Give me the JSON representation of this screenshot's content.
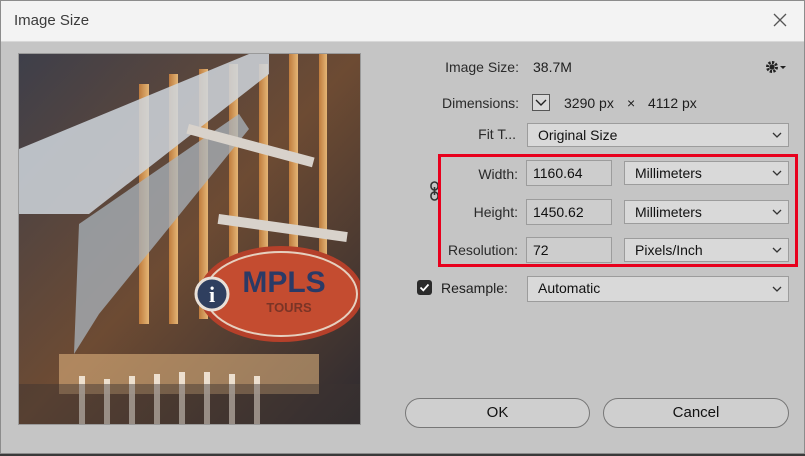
{
  "window": {
    "title": "Image Size"
  },
  "info": {
    "image_size_label": "Image Size:",
    "image_size_value": "38.7M",
    "dimensions_label": "Dimensions:",
    "dim_width": "3290 px",
    "dim_times": "×",
    "dim_height": "4112 px"
  },
  "fit": {
    "label": "Fit T...",
    "value": "Original Size"
  },
  "width": {
    "label": "Width:",
    "value": "1160.64",
    "unit": "Millimeters"
  },
  "height": {
    "label": "Height:",
    "value": "1450.62",
    "unit": "Millimeters"
  },
  "resolution": {
    "label": "Resolution:",
    "value": "72",
    "unit": "Pixels/Inch"
  },
  "resample": {
    "label": "Resample:",
    "checked": true,
    "value": "Automatic"
  },
  "buttons": {
    "ok": "OK",
    "cancel": "Cancel"
  },
  "preview": {
    "sign_text": "MPLS",
    "sign_subtext": "TOURS",
    "sign_info": "i"
  },
  "colors": {
    "highlight": "#e8001d",
    "dialog_bg": "#c5c5c5",
    "titlebar_bg": "#f3f3f3"
  },
  "icons": {
    "close": "close-icon",
    "gear": "gear-icon",
    "chevron": "chevron-down-icon",
    "link": "link-icon",
    "check": "checkmark-icon"
  }
}
